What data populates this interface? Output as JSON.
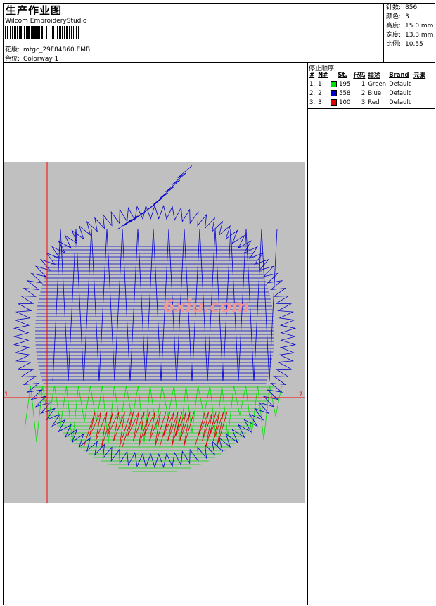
{
  "header": {
    "title": "生产作业图",
    "software": "Wilcom EmbroideryStudio",
    "design_label": "花版:",
    "design_value": "mtgc_29F84860.EMB",
    "colorway_label": "色位:",
    "colorway_value": "Colorway 1"
  },
  "stats": [
    {
      "label": "针数:",
      "value": "856"
    },
    {
      "label": "颜色:",
      "value": "3"
    },
    {
      "label": "高度:",
      "value": "15.0 mm"
    },
    {
      "label": "宽度:",
      "value": "13.3 mm"
    },
    {
      "label": "比例:",
      "value": "10.55"
    }
  ],
  "stop_sequence": {
    "title": "停止顺序:",
    "headers": [
      "#",
      "N#",
      "St.",
      "代码",
      "描述",
      "Brand",
      "元素"
    ],
    "rows": [
      {
        "idx": "1.",
        "n": "1",
        "color": "#00dd00",
        "st": "195",
        "code": "1",
        "desc": "Green",
        "brand": "Default"
      },
      {
        "idx": "2.",
        "n": "2",
        "color": "#0000cc",
        "st": "558",
        "code": "2",
        "desc": "Blue",
        "brand": "Default"
      },
      {
        "idx": "3.",
        "n": "3",
        "color": "#dd0000",
        "st": "100",
        "code": "3",
        "desc": "Red",
        "brand": "Default"
      }
    ]
  },
  "canvas": {
    "background": "#c0c0c0",
    "axis_color": "#ff0000",
    "marker_left": "1",
    "marker_right": "2",
    "watermark": "6xiu.com"
  }
}
